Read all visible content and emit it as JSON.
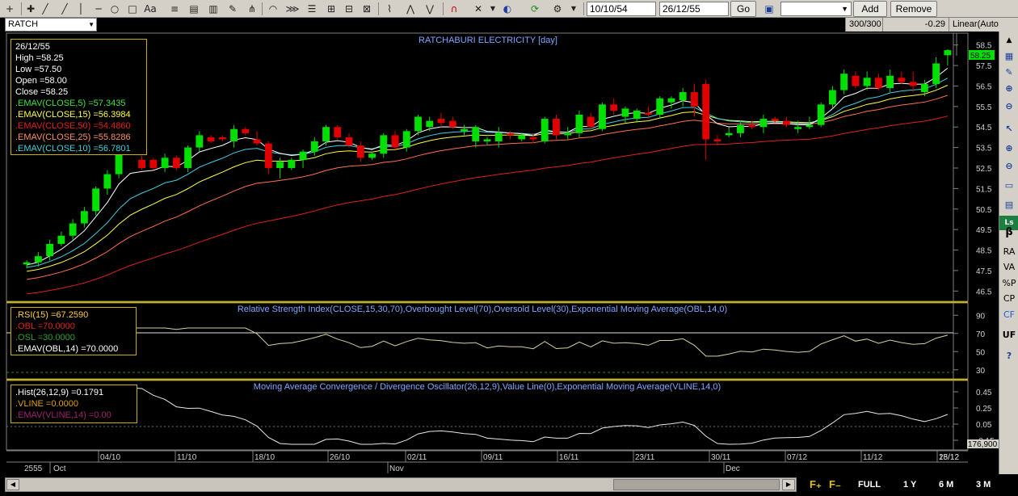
{
  "toolbar": {
    "text_tool_label": "Aa",
    "from_date": "10/10/54",
    "to_date": "26/12/55",
    "go_label": "Go",
    "combo_value": "",
    "add_label": "Add",
    "remove_label": "Remove"
  },
  "symbol": "RATCH",
  "status": {
    "bars": "300/300",
    "change": "-0.29",
    "scale": "Linear(Auto"
  },
  "info_main": {
    "date": "26/12/55",
    "high": "High  =58.25",
    "low": "Low  =57.50",
    "open": "Open  =58.00",
    "close": "Close  =58.25",
    "ema5": ".EMAV(CLOSE,5)    =57.3435",
    "ema15": ".EMAV(CLOSE,15)   =56.3984",
    "ema50": ".EMAV(CLOSE,50)   =54.4860",
    "ema25": ".EMAV(CLOSE,25)   =55.8286",
    "ema10": ".EMAV(CLOSE,10)   =56.7801"
  },
  "info_rsi": {
    "rsi": ".RSI(15)   =67.2590",
    "obl": ".OBL   =70.0000",
    "osl": ".OSL   =30.0000",
    "emav": ".EMAV(OBL,14)   =70.0000"
  },
  "info_macd": {
    "hist": ".Hist(26,12,9)   =0.1791",
    "vline": ".VLINE   =0.0000",
    "emav": ".EMAV(VLINE,14)   =0.00"
  },
  "titles": {
    "main": "RATCHABURI ELECTRICITY [day]",
    "rsi": "Relative Strength Index(CLOSE,15,30,70),Overbought Level(70),Oversold Level(30),Exponential Moving Average(OBL,14,0)",
    "macd": "Moving Average Convergence / Divergence Oscillator(26,12,9),Value Line(0),Exponential Moving Average(VLINE,14,0)"
  },
  "colors": {
    "up": "#00e000",
    "down": "#e00000",
    "ema5": "#ffffff",
    "ema10": "#40d0e0",
    "ema15": "#ffff40",
    "ema25": "#ff7050",
    "ema50": "#e02020",
    "pane_border": "#c8b400",
    "title": "#7fa6ff"
  },
  "axes": {
    "main_ticks": [
      "58.5",
      "57.5",
      "56.5",
      "55.5",
      "54.5",
      "53.5",
      "52.5",
      "51.5",
      "50.5",
      "49.5",
      "48.5",
      "47.5",
      "46.5"
    ],
    "price_tag": "58.25",
    "rsi_ticks": [
      "90",
      "70",
      "50",
      "30"
    ],
    "macd_ticks": [
      "0.45",
      "0.25",
      "0.05",
      "-0.15"
    ],
    "macd_tag": "176,900",
    "dates": [
      "04/10",
      "11/10",
      "18/10",
      "26/10",
      "02/11",
      "09/11",
      "16/11",
      "23/11",
      "30/11",
      "07/12",
      "11/12",
      "18/12",
      "25/12"
    ],
    "year": "2555",
    "months": [
      "Oct",
      "Nov",
      "Dec"
    ]
  },
  "chart_data": {
    "type": "candlestick",
    "title": "RATCHABURI ELECTRICITY [day]",
    "ylim": [
      46.0,
      59.0
    ],
    "candles": [
      [
        47.8,
        48.0,
        47.6,
        47.9
      ],
      [
        47.9,
        48.4,
        47.7,
        48.2
      ],
      [
        48.2,
        49.0,
        48.0,
        48.8
      ],
      [
        48.8,
        49.4,
        48.7,
        49.2
      ],
      [
        49.2,
        50.0,
        49.0,
        49.8
      ],
      [
        49.8,
        50.6,
        49.6,
        50.4
      ],
      [
        50.4,
        51.6,
        50.2,
        51.5
      ],
      [
        51.5,
        52.4,
        51.2,
        52.2
      ],
      [
        52.2,
        53.6,
        52.0,
        53.5
      ],
      [
        53.4,
        53.6,
        53.2,
        53.3
      ],
      [
        52.9,
        53.1,
        52.4,
        52.5
      ],
      [
        52.9,
        53.0,
        52.4,
        52.5
      ],
      [
        52.5,
        53.2,
        52.3,
        53.0
      ],
      [
        53.0,
        53.1,
        52.4,
        52.5
      ],
      [
        52.5,
        53.6,
        52.3,
        53.5
      ],
      [
        53.5,
        54.3,
        53.3,
        54.1
      ],
      [
        54.0,
        54.1,
        53.7,
        53.8
      ],
      [
        54.0,
        54.1,
        53.8,
        53.9
      ],
      [
        53.8,
        54.6,
        53.5,
        54.4
      ],
      [
        54.4,
        54.5,
        54.1,
        54.2
      ],
      [
        53.9,
        54.3,
        53.6,
        53.7
      ],
      [
        53.7,
        53.8,
        52.2,
        52.5
      ],
      [
        52.5,
        53.0,
        52.0,
        52.8
      ],
      [
        52.5,
        53.0,
        52.4,
        52.9
      ],
      [
        52.9,
        53.4,
        52.5,
        53.3
      ],
      [
        53.3,
        54.0,
        53.1,
        53.8
      ],
      [
        53.8,
        54.6,
        53.6,
        54.5
      ],
      [
        54.5,
        54.6,
        53.9,
        54.0
      ],
      [
        54.0,
        54.2,
        53.5,
        53.6
      ],
      [
        53.6,
        53.8,
        52.8,
        53.0
      ],
      [
        53.0,
        53.3,
        52.9,
        53.2
      ],
      [
        53.2,
        54.2,
        53.0,
        54.1
      ],
      [
        54.1,
        54.3,
        53.4,
        53.5
      ],
      [
        53.5,
        54.4,
        53.3,
        54.3
      ],
      [
        54.3,
        55.1,
        54.1,
        55.0
      ],
      [
        54.5,
        55.0,
        54.3,
        54.8
      ],
      [
        54.9,
        55.2,
        54.5,
        54.7
      ],
      [
        54.8,
        55.0,
        54.4,
        54.5
      ],
      [
        54.3,
        54.6,
        54.1,
        54.4
      ],
      [
        53.8,
        54.6,
        53.5,
        54.5
      ],
      [
        53.8,
        54.0,
        53.6,
        53.9
      ],
      [
        53.8,
        54.5,
        53.5,
        54.2
      ],
      [
        54.2,
        54.3,
        53.9,
        54.1
      ],
      [
        53.9,
        54.2,
        53.8,
        54.1
      ],
      [
        54.0,
        54.2,
        53.7,
        53.9
      ],
      [
        53.8,
        55.0,
        53.7,
        54.9
      ],
      [
        54.9,
        55.1,
        53.9,
        54.1
      ],
      [
        54.1,
        54.5,
        53.9,
        54.2
      ],
      [
        54.2,
        55.3,
        54.0,
        55.1
      ],
      [
        55.0,
        55.2,
        54.4,
        54.5
      ],
      [
        54.4,
        55.7,
        54.3,
        55.6
      ],
      [
        55.6,
        55.9,
        55.1,
        55.3
      ],
      [
        55.0,
        55.5,
        54.7,
        55.4
      ],
      [
        54.9,
        55.4,
        54.7,
        55.3
      ],
      [
        55.2,
        55.5,
        54.9,
        55.1
      ],
      [
        55.1,
        56.0,
        54.9,
        55.9
      ],
      [
        55.7,
        56.0,
        55.4,
        55.9
      ],
      [
        55.8,
        56.4,
        55.5,
        56.2
      ],
      [
        56.2,
        56.6,
        55.0,
        55.5
      ],
      [
        56.6,
        56.8,
        52.9,
        53.9
      ],
      [
        53.9,
        54.1,
        53.6,
        53.8
      ],
      [
        54.1,
        54.5,
        54.0,
        54.2
      ],
      [
        54.2,
        54.8,
        54.0,
        54.6
      ],
      [
        54.6,
        54.8,
        54.4,
        54.5
      ],
      [
        54.5,
        55.1,
        54.2,
        54.9
      ],
      [
        54.9,
        55.0,
        54.7,
        54.8
      ],
      [
        54.8,
        55.0,
        54.5,
        54.6
      ],
      [
        54.4,
        54.8,
        54.2,
        54.5
      ],
      [
        54.5,
        55.0,
        54.4,
        54.6
      ],
      [
        54.6,
        55.7,
        54.5,
        55.6
      ],
      [
        55.6,
        56.5,
        55.4,
        56.3
      ],
      [
        56.3,
        57.3,
        56.1,
        57.1
      ],
      [
        57.0,
        57.2,
        56.4,
        56.5
      ],
      [
        56.5,
        57.2,
        56.3,
        56.9
      ],
      [
        56.9,
        57.1,
        56.3,
        56.4
      ],
      [
        56.4,
        57.3,
        56.2,
        57.0
      ],
      [
        56.9,
        57.2,
        56.6,
        56.7
      ],
      [
        56.7,
        57.2,
        56.2,
        56.5
      ],
      [
        56.2,
        56.8,
        56.0,
        56.6
      ],
      [
        56.6,
        57.9,
        56.4,
        57.6
      ],
      [
        58.0,
        58.3,
        57.5,
        58.25
      ]
    ]
  }
}
